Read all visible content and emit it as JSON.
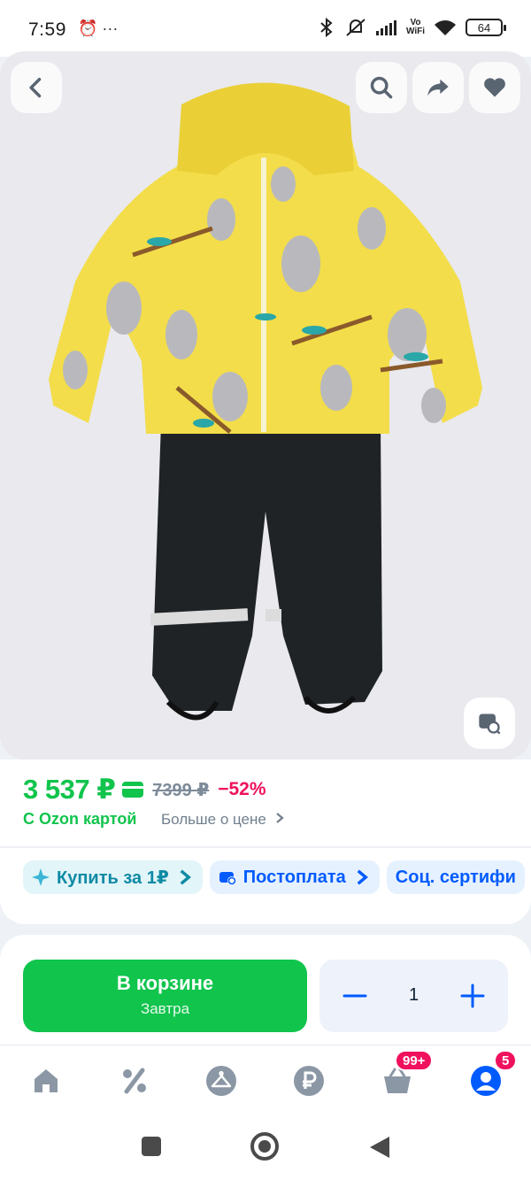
{
  "status_bar": {
    "time": "7:59",
    "left_icons": "⏰ ···",
    "vowifi_top": "Vo",
    "vowifi_bottom": "WiFi",
    "battery": "64"
  },
  "product": {
    "image_description_icon": "kids-koala-jacket-pants-set",
    "colors": {
      "jacket": "#f3dd4a",
      "pants": "#1f2326",
      "koala": "#b9b9bd"
    }
  },
  "price": {
    "current": "3 537 ₽",
    "old": "7399 ₽",
    "discount": "−52%",
    "ozon_card_label": "С Ozon картой",
    "more_label": "Больше о цене"
  },
  "chips": [
    {
      "label": "Купить за 1₽",
      "icon": "sparkle-icon"
    },
    {
      "label": "Постоплата",
      "icon": "card-clock-icon"
    },
    {
      "label": "Соц. сертифи",
      "icon": ""
    }
  ],
  "cart": {
    "button_label": "В корзине",
    "button_sub": "Завтра",
    "quantity": "1"
  },
  "bottom_nav": {
    "cart_badge": "99+",
    "profile_badge": "5",
    "colors": {
      "active": "#005bff",
      "inactive": "#8b97a5"
    }
  },
  "colors": {
    "accent_green": "#10c44c",
    "discount_pink": "#f0115e",
    "ozon_blue": "#005bff"
  }
}
